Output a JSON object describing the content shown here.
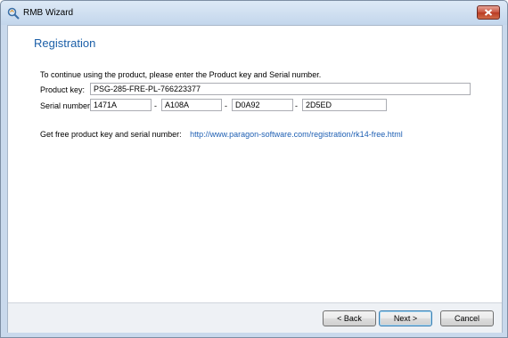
{
  "window": {
    "title": "RMB Wizard",
    "close_glyph": "×"
  },
  "page": {
    "heading": "Registration",
    "instruction": "To continue using the product, please enter the Product key and Serial number."
  },
  "form": {
    "product_key_label": "Product key:",
    "product_key_value": "PSG-285-FRE-PL-766223377",
    "serial_label": "Serial number:",
    "serial_parts": [
      "1471A",
      "A108A",
      "D0A92",
      "2D5ED"
    ],
    "separator": "-"
  },
  "free_key": {
    "label": "Get free product key and serial number:",
    "url": "http://www.paragon-software.com/registration/rk14-free.html"
  },
  "buttons": {
    "back": "< Back",
    "next": "Next >",
    "cancel": "Cancel"
  },
  "colors": {
    "heading": "#1b5fa8",
    "link": "#1e5fb3",
    "close_button": "#c8523d"
  },
  "icons": {
    "app": "magnifier-wizard-icon",
    "close": "close-icon"
  }
}
